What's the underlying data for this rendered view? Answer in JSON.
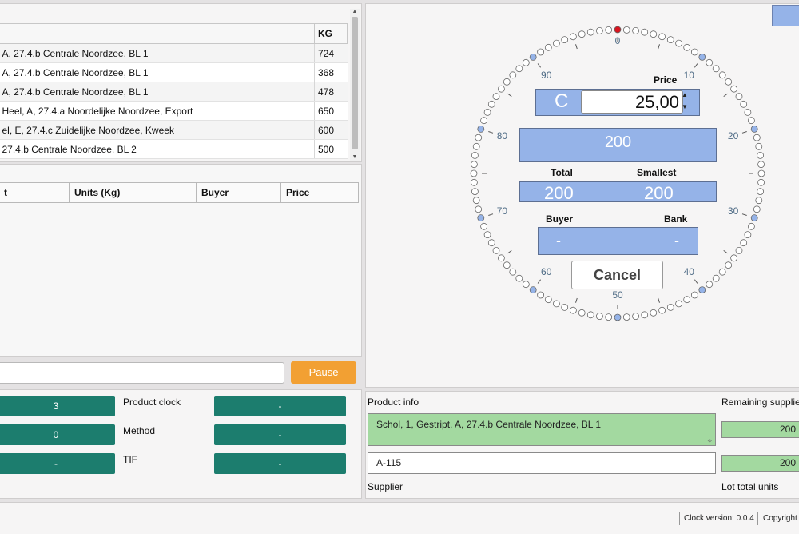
{
  "lots_table": {
    "headers": {
      "product": "",
      "kg": "KG"
    },
    "rows": [
      {
        "product": "A, 27.4.b Centrale Noordzee, BL 1",
        "kg": "724"
      },
      {
        "product": "A, 27.4.b Centrale Noordzee, BL 1",
        "kg": "368"
      },
      {
        "product": "A, 27.4.b Centrale Noordzee, BL 1",
        "kg": "478"
      },
      {
        "product": "Heel, A, 27.4.a Noordelijke Noordzee, Export",
        "kg": "650"
      },
      {
        "product": "el, E, 27.4.c Zuidelijke Noordzee, Kweek",
        "kg": "600"
      },
      {
        "product": " 27.4.b Centrale Noordzee, BL 2",
        "kg": "500"
      }
    ]
  },
  "sales_table": {
    "headers": [
      "t",
      "Units (Kg)",
      "Buyer",
      "Price"
    ]
  },
  "controls": {
    "search_value": "",
    "pause_label": "Pause"
  },
  "status": {
    "values_left": [
      "3",
      "0",
      "-"
    ],
    "labels": [
      "Product clock",
      "Method",
      "TIF"
    ],
    "values_right": [
      "-",
      "-",
      "-"
    ]
  },
  "clock": {
    "price_label": "Price",
    "currency_letter": "C",
    "price_value": "25,00",
    "quantity_value": "200",
    "total_label": "Total",
    "smallest_label": "Smallest",
    "total_value": "200",
    "smallest_value": "200",
    "buyer_label": "Buyer",
    "bank_label": "Bank",
    "buyer_value": "-",
    "bank_value": "-",
    "cancel_label": "Cancel",
    "dial_numbers": [
      "0",
      "10",
      "20",
      "30",
      "40",
      "50",
      "60",
      "70",
      "80",
      "90"
    ],
    "dial_color": "#95b3e8",
    "active_color": "#d8141f"
  },
  "product_info": {
    "title": "Product info",
    "description": "Schol, 1, Gestript, A, 27.4.b Centrale Noordzee, BL 1",
    "supplier_code": "A-115",
    "supplier_label": "Supplier",
    "remaining_label": "Remaining supplier",
    "remaining_value": "200",
    "lot_total_value": "200",
    "lot_total_label": "Lot total units"
  },
  "footer": {
    "clock_version": "Clock version: 0.0.4",
    "copyright": "Copyright"
  }
}
